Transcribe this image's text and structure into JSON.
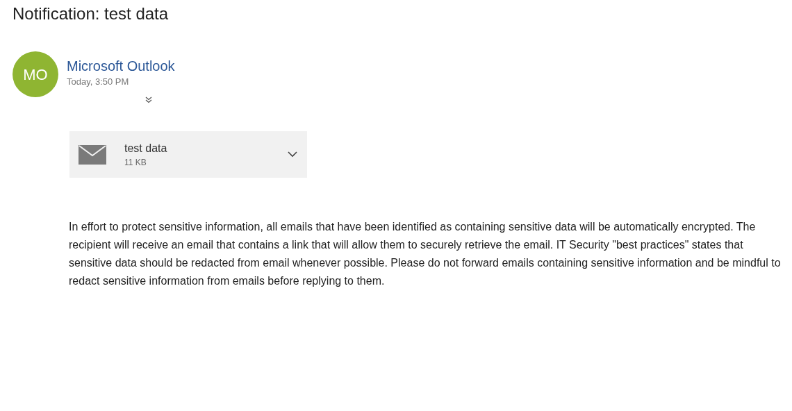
{
  "subject": "Notification: test data",
  "sender": {
    "initials": "MO",
    "name": "Microsoft Outlook",
    "time": "Today, 3:50 PM",
    "color": "#8fb532"
  },
  "attachment": {
    "name": "test data",
    "size": "11 KB"
  },
  "body": "In effort to protect sensitive information, all emails that have been identified as containing sensitive data will be automatically encrypted. The recipient will receive an email that contains a link that will allow them to securely retrieve the email. IT Security \"best practices\" states that sensitive data should be redacted from email whenever possible. Please do not forward emails containing sensitive information and be mindful to redact sensitive information from emails before replying to them."
}
